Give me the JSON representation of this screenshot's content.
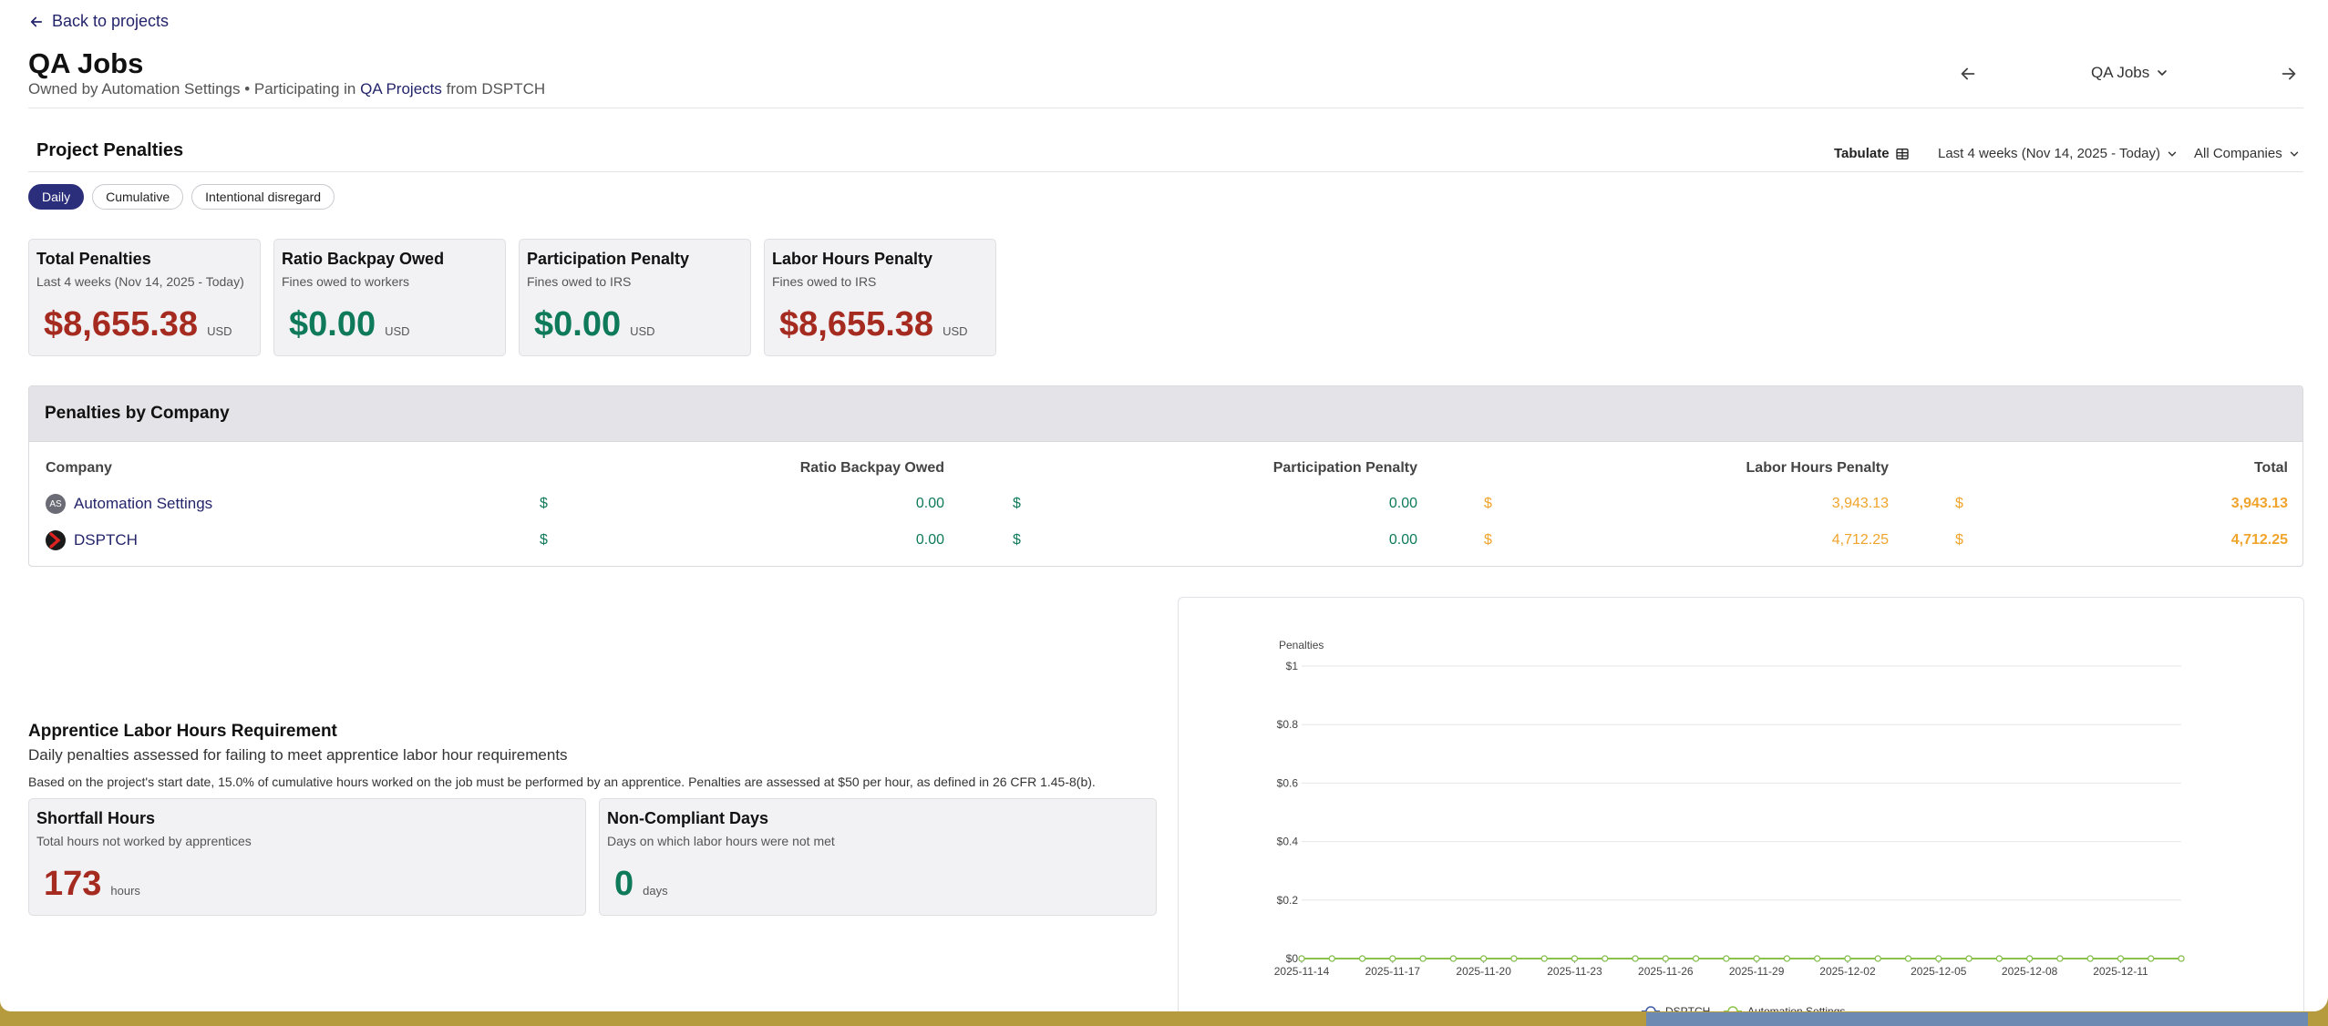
{
  "header": {
    "back_label": "Back to projects",
    "title": "QA Jobs",
    "subtitle_prefix": "Owned by Automation Settings • Participating in ",
    "subtitle_link": "QA Projects",
    "subtitle_suffix": " from DSPTCH",
    "job_selector": "QA Jobs"
  },
  "penalties": {
    "section_title": "Project Penalties",
    "tabulate_label": "Tabulate",
    "range_label": "Last 4 weeks (Nov 14, 2025 - Today)",
    "companies_label": "All Companies",
    "pills": [
      "Daily",
      "Cumulative",
      "Intentional disregard"
    ],
    "cards": [
      {
        "title": "Total Penalties",
        "subtitle": "Last 4 weeks (Nov 14, 2025 - Today)",
        "value": "$8,655.38",
        "unit": "USD"
      },
      {
        "title": "Ratio Backpay Owed",
        "subtitle": "Fines owed to workers",
        "value": "$0.00",
        "unit": "USD"
      },
      {
        "title": "Participation Penalty",
        "subtitle": "Fines owed to IRS",
        "value": "$0.00",
        "unit": "USD"
      },
      {
        "title": "Labor Hours Penalty",
        "subtitle": "Fines owed to IRS",
        "value": "$8,655.38",
        "unit": "USD"
      }
    ]
  },
  "by_company": {
    "title": "Penalties by Company",
    "columns": [
      "Company",
      "Ratio Backpay Owed",
      "Participation Penalty",
      "Labor Hours Penalty",
      "Total"
    ],
    "currency": "$",
    "rows": [
      {
        "initials": "AS",
        "company": "Automation Settings",
        "ratio": "0.00",
        "participation": "0.00",
        "labor": "3,943.13",
        "total": "3,943.13"
      },
      {
        "initials": "",
        "company": "DSPTCH",
        "ratio": "0.00",
        "participation": "0.00",
        "labor": "4,712.25",
        "total": "4,712.25"
      }
    ]
  },
  "apprentice": {
    "title": "Apprentice Labor Hours Requirement",
    "subtitle": "Daily penalties assessed for failing to meet apprentice labor hour requirements",
    "note": "Based on the project's start date, 15.0% of cumulative hours worked on the job must be performed by an apprentice. Penalties are assessed at $50 per hour, as defined in 26 CFR 1.45-8(b).",
    "cards": [
      {
        "title": "Shortfall Hours",
        "subtitle": "Total hours not worked by apprentices",
        "value": "173",
        "unit": "hours"
      },
      {
        "title": "Non-Compliant Days",
        "subtitle": "Days on which labor hours were not met",
        "value": "0",
        "unit": "days"
      }
    ]
  },
  "chart_data": {
    "type": "line",
    "ylabel": "Penalties",
    "ylim": [
      0,
      1
    ],
    "yticks": [
      "$0",
      "$0.2",
      "$0.4",
      "$0.6",
      "$0.8",
      "$1"
    ],
    "x": [
      "2025-11-14",
      "2025-11-15",
      "2025-11-16",
      "2025-11-17",
      "2025-11-18",
      "2025-11-19",
      "2025-11-20",
      "2025-11-21",
      "2025-11-22",
      "2025-11-23",
      "2025-11-24",
      "2025-11-25",
      "2025-11-26",
      "2025-11-27",
      "2025-11-28",
      "2025-11-29",
      "2025-11-30",
      "2025-12-01",
      "2025-12-02",
      "2025-12-03",
      "2025-12-04",
      "2025-12-05",
      "2025-12-06",
      "2025-12-07",
      "2025-12-08",
      "2025-12-09",
      "2025-12-10",
      "2025-12-11",
      "2025-12-12",
      "2025-12-13"
    ],
    "xticks": [
      "2025-11-14",
      "2025-11-17",
      "2025-11-20",
      "2025-11-23",
      "2025-11-26",
      "2025-11-29",
      "2025-12-02",
      "2025-12-05",
      "2025-12-08",
      "2025-12-11"
    ],
    "series": [
      {
        "name": "DSPTCH",
        "color": "#3b5ba5",
        "values": [
          0,
          0,
          0,
          0,
          0,
          0,
          0,
          0,
          0,
          0,
          0,
          0,
          0,
          0,
          0,
          0,
          0,
          0,
          0,
          0,
          0,
          0,
          0,
          0,
          0,
          0,
          0,
          0,
          0,
          0
        ]
      },
      {
        "name": "Automation Settings",
        "color": "#8bc34a",
        "values": [
          0,
          0,
          0,
          0,
          0,
          0,
          0,
          0,
          0,
          0,
          0,
          0,
          0,
          0,
          0,
          0,
          0,
          0,
          0,
          0,
          0,
          0,
          0,
          0,
          0,
          0,
          0,
          0,
          0,
          0
        ]
      }
    ],
    "grid": true,
    "legend": "bottom"
  },
  "colors": {
    "accent": "#2b2e7a",
    "penalty_red": "#a52a1f",
    "zero_green": "#0f7a5a",
    "labor_orange": "#f0a42b"
  }
}
